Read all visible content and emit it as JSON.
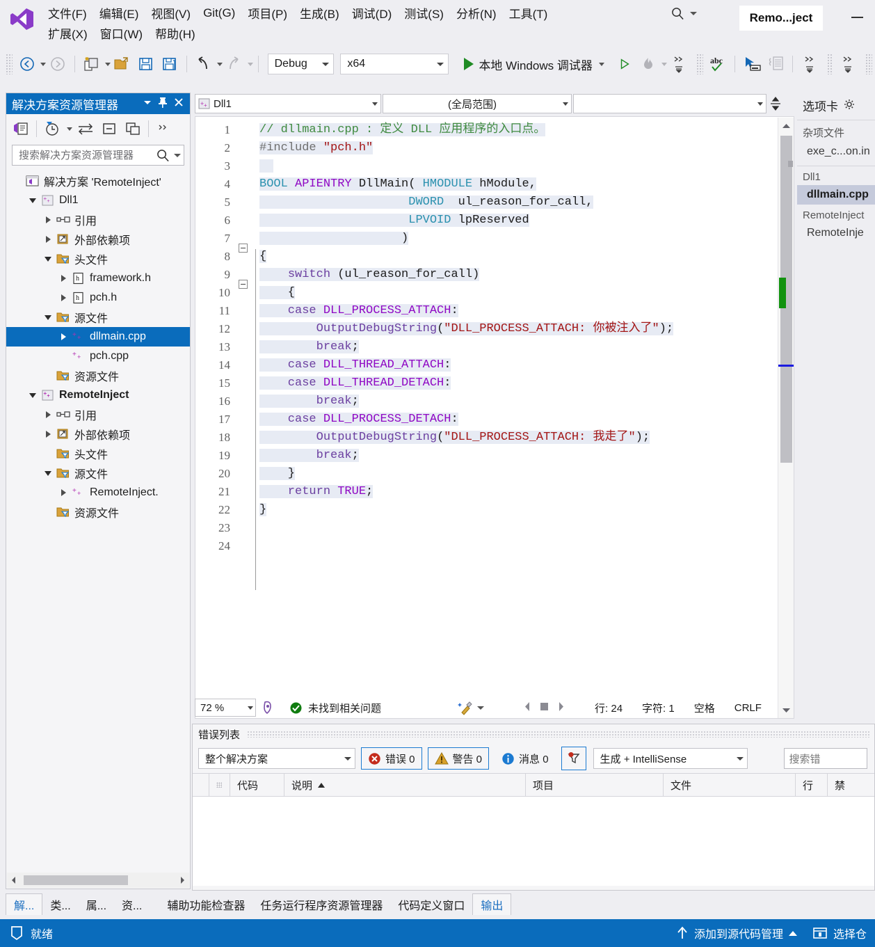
{
  "window": {
    "project_label": "Remo...ject",
    "minimize_icon": "minimize-icon"
  },
  "menubar": {
    "items": [
      {
        "text": "文件(F)",
        "accel": "F"
      },
      {
        "text": "编辑(E)",
        "accel": "E"
      },
      {
        "text": "视图(V)",
        "accel": "V"
      },
      {
        "text": "Git(G)",
        "accel": "G"
      },
      {
        "text": "项目(P)",
        "accel": "P"
      },
      {
        "text": "生成(B)",
        "accel": "B"
      },
      {
        "text": "调试(D)",
        "accel": "D"
      },
      {
        "text": "测试(S)",
        "accel": "S"
      },
      {
        "text": "分析(N)",
        "accel": "N"
      },
      {
        "text": "工具(T)",
        "accel": "T"
      },
      {
        "text": "扩展(X)",
        "accel": "X"
      },
      {
        "text": "窗口(W)",
        "accel": "W"
      },
      {
        "text": "帮助(H)",
        "accel": "H"
      }
    ],
    "row1": [
      "文件(F)",
      "编辑(E)",
      "视图(V)",
      "Git(G)",
      "项目(P)",
      "生成(B)",
      "调试(D)",
      "测试(S)",
      "分析(N)",
      "工具(T)"
    ],
    "row2": [
      "扩展(X)",
      "窗口(W)",
      "帮助(H)"
    ]
  },
  "toolbar": {
    "config": "Debug",
    "platform": "x64",
    "run_label": "本地 Windows 调试器",
    "icons": [
      "navigate-back-icon",
      "navigate-forward-icon",
      "new-item-icon",
      "open-file-icon",
      "save-icon",
      "save-all-icon",
      "undo-icon",
      "redo-icon",
      "start-debug-icon",
      "start-without-debug-icon",
      "hot-reload-icon",
      "spellcheck-icon",
      "select-element-icon",
      "layout-icon"
    ]
  },
  "solution_explorer": {
    "title": "解决方案资源管理器",
    "search_placeholder": "搜索解决方案资源管理器",
    "toolbar_icons": [
      "home-icon",
      "pending-changes-icon",
      "sync-with-active-doc-icon",
      "collapse-all-icon",
      "properties-icon",
      "overflow-icon"
    ],
    "tree": [
      {
        "label": "解决方案 'RemoteInject'",
        "indent": 0,
        "twisty": "none",
        "icon": "solution-icon",
        "selected": false,
        "bold": false
      },
      {
        "label": "Dll1",
        "indent": 1,
        "twisty": "down",
        "icon": "cpp-project-icon",
        "selected": false,
        "bold": false
      },
      {
        "label": "引用",
        "indent": 2,
        "twisty": "right",
        "icon": "references-icon",
        "selected": false,
        "bold": false
      },
      {
        "label": "外部依赖项",
        "indent": 2,
        "twisty": "right",
        "icon": "external-deps-icon",
        "selected": false,
        "bold": false
      },
      {
        "label": "头文件",
        "indent": 2,
        "twisty": "down",
        "icon": "filter-folder-icon",
        "selected": false,
        "bold": false
      },
      {
        "label": "framework.h",
        "indent": 3,
        "twisty": "right",
        "icon": "header-file-icon",
        "selected": false,
        "bold": false
      },
      {
        "label": "pch.h",
        "indent": 3,
        "twisty": "right",
        "icon": "header-file-icon",
        "selected": false,
        "bold": false
      },
      {
        "label": "源文件",
        "indent": 2,
        "twisty": "down",
        "icon": "filter-folder-icon",
        "selected": false,
        "bold": false
      },
      {
        "label": "dllmain.cpp",
        "indent": 3,
        "twisty": "right",
        "icon": "cpp-file-icon",
        "selected": true,
        "bold": false
      },
      {
        "label": "pch.cpp",
        "indent": 3,
        "twisty": "none",
        "icon": "cpp-file-icon",
        "selected": false,
        "bold": false
      },
      {
        "label": "资源文件",
        "indent": 2,
        "twisty": "none",
        "icon": "filter-folder-icon",
        "selected": false,
        "bold": false
      },
      {
        "label": "RemoteInject",
        "indent": 1,
        "twisty": "down",
        "icon": "cpp-project-icon",
        "selected": false,
        "bold": true
      },
      {
        "label": "引用",
        "indent": 2,
        "twisty": "right",
        "icon": "references-icon",
        "selected": false,
        "bold": false
      },
      {
        "label": "外部依赖项",
        "indent": 2,
        "twisty": "right",
        "icon": "external-deps-icon",
        "selected": false,
        "bold": false
      },
      {
        "label": "头文件",
        "indent": 2,
        "twisty": "none",
        "icon": "filter-folder-icon",
        "selected": false,
        "bold": false
      },
      {
        "label": "源文件",
        "indent": 2,
        "twisty": "down",
        "icon": "filter-folder-icon",
        "selected": false,
        "bold": false
      },
      {
        "label": "RemoteInject.",
        "indent": 3,
        "twisty": "right",
        "icon": "cpp-file-icon",
        "selected": false,
        "bold": false
      },
      {
        "label": "资源文件",
        "indent": 2,
        "twisty": "none",
        "icon": "filter-folder-icon",
        "selected": false,
        "bold": false
      }
    ]
  },
  "editor": {
    "nav_project": "Dll1",
    "nav_scope": "(全局范围)",
    "nav_member": "",
    "lines": [
      {
        "n": 1,
        "fold": "",
        "chg": "",
        "segs": [
          {
            "t": "// dllmain.cpp : 定义 DLL 应用程序的入口点。",
            "c": "cmt",
            "hl": true
          }
        ]
      },
      {
        "n": 2,
        "fold": "",
        "chg": "",
        "segs": [
          {
            "t": "#include ",
            "c": "mac",
            "hl": true
          },
          {
            "t": "\"pch.h\"",
            "c": "str",
            "hl": true
          }
        ]
      },
      {
        "n": 3,
        "fold": "",
        "chg": "",
        "segs": [
          {
            "t": "  ",
            "c": "pl",
            "hl": true
          }
        ]
      },
      {
        "n": 4,
        "fold": "",
        "chg": "",
        "segs": [
          {
            "t": "BOOL ",
            "c": "typ",
            "hl": true
          },
          {
            "t": "APIENTRY ",
            "c": "kw2",
            "hl": true
          },
          {
            "t": "DllMain",
            "c": "pl",
            "hl": true
          },
          {
            "t": "( ",
            "c": "pl",
            "hl": true
          },
          {
            "t": "HMODULE ",
            "c": "typ",
            "hl": true
          },
          {
            "t": "hModule,",
            "c": "pl",
            "hl": true
          }
        ]
      },
      {
        "n": 5,
        "fold": "",
        "chg": "",
        "segs": [
          {
            "t": "                     ",
            "c": "pl",
            "hl": true
          },
          {
            "t": "DWORD  ",
            "c": "typ",
            "hl": true
          },
          {
            "t": "ul_reason_for_call,",
            "c": "pl",
            "hl": true
          }
        ]
      },
      {
        "n": 6,
        "fold": "",
        "chg": "",
        "segs": [
          {
            "t": "                     ",
            "c": "pl",
            "hl": true
          },
          {
            "t": "LPVOID ",
            "c": "typ",
            "hl": true
          },
          {
            "t": "lpReserved",
            "c": "pl",
            "hl": true
          }
        ]
      },
      {
        "n": 7,
        "fold": "box",
        "chg": "",
        "segs": [
          {
            "t": "                    )",
            "c": "pl",
            "hl": true
          }
        ]
      },
      {
        "n": 8,
        "fold": "",
        "chg": "",
        "segs": [
          {
            "t": "{",
            "c": "pl",
            "hl": true
          }
        ]
      },
      {
        "n": 9,
        "fold": "box",
        "chg": "",
        "segs": [
          {
            "t": "    ",
            "c": "pl",
            "hl": true
          },
          {
            "t": "switch ",
            "c": "fn",
            "hl": true
          },
          {
            "t": "(ul_reason_for_call)",
            "c": "pl",
            "hl": true
          }
        ]
      },
      {
        "n": 10,
        "fold": "",
        "chg": "",
        "segs": [
          {
            "t": "    {",
            "c": "pl",
            "hl": true
          }
        ]
      },
      {
        "n": 11,
        "fold": "",
        "chg": "",
        "segs": [
          {
            "t": "    case ",
            "c": "fn",
            "hl": true
          },
          {
            "t": "DLL_PROCESS_ATTACH",
            "c": "kw2",
            "hl": true
          },
          {
            "t": ":",
            "c": "pl",
            "hl": true
          }
        ]
      },
      {
        "n": 12,
        "fold": "",
        "chg": "",
        "segs": [
          {
            "t": "        ",
            "c": "pl",
            "hl": true
          },
          {
            "t": "OutputDebugString",
            "c": "fn",
            "hl": true
          },
          {
            "t": "(",
            "c": "pl",
            "hl": true
          },
          {
            "t": "\"DLL_PROCESS_ATTACH: 你被注入了\"",
            "c": "str",
            "hl": true
          },
          {
            "t": ");",
            "c": "pl",
            "hl": true
          }
        ]
      },
      {
        "n": 13,
        "fold": "",
        "chg": "",
        "segs": [
          {
            "t": "        ",
            "c": "pl",
            "hl": true
          },
          {
            "t": "break",
            "c": "fn",
            "hl": true
          },
          {
            "t": ";",
            "c": "pl",
            "hl": true
          }
        ]
      },
      {
        "n": 14,
        "fold": "",
        "chg": "",
        "segs": [
          {
            "t": "    case ",
            "c": "fn",
            "hl": true
          },
          {
            "t": "DLL_THREAD_ATTACH",
            "c": "kw2",
            "hl": true
          },
          {
            "t": ":",
            "c": "pl",
            "hl": true
          }
        ]
      },
      {
        "n": 15,
        "fold": "",
        "chg": "green",
        "segs": [
          {
            "t": "    case ",
            "c": "fn",
            "hl": true
          },
          {
            "t": "DLL_THREAD_DETACH",
            "c": "kw2",
            "hl": true
          },
          {
            "t": ":",
            "c": "pl",
            "hl": true
          }
        ]
      },
      {
        "n": 16,
        "fold": "",
        "chg": "green",
        "segs": [
          {
            "t": "        ",
            "c": "pl",
            "hl": true
          },
          {
            "t": "break",
            "c": "fn",
            "hl": true
          },
          {
            "t": ";",
            "c": "pl",
            "hl": true
          }
        ]
      },
      {
        "n": 17,
        "fold": "",
        "chg": "",
        "segs": [
          {
            "t": "    case ",
            "c": "fn",
            "hl": true
          },
          {
            "t": "DLL_PROCESS_DETACH",
            "c": "kw2",
            "hl": true
          },
          {
            "t": ":",
            "c": "pl",
            "hl": true
          }
        ]
      },
      {
        "n": 18,
        "fold": "",
        "chg": "",
        "segs": [
          {
            "t": "        ",
            "c": "pl",
            "hl": true
          },
          {
            "t": "OutputDebugString",
            "c": "fn",
            "hl": true
          },
          {
            "t": "(",
            "c": "pl",
            "hl": true
          },
          {
            "t": "\"DLL_PROCESS_ATTACH: 我走了\"",
            "c": "str",
            "hl": true
          },
          {
            "t": ");",
            "c": "pl",
            "hl": true
          }
        ]
      },
      {
        "n": 19,
        "fold": "",
        "chg": "",
        "segs": [
          {
            "t": "        ",
            "c": "pl",
            "hl": true
          },
          {
            "t": "break",
            "c": "fn",
            "hl": true
          },
          {
            "t": ";",
            "c": "pl",
            "hl": true
          }
        ]
      },
      {
        "n": 20,
        "fold": "",
        "chg": "",
        "segs": [
          {
            "t": "    }",
            "c": "pl",
            "hl": true
          }
        ]
      },
      {
        "n": 21,
        "fold": "",
        "chg": "",
        "segs": [
          {
            "t": "    return ",
            "c": "fn",
            "hl": true
          },
          {
            "t": "TRUE",
            "c": "kw2",
            "hl": true
          },
          {
            "t": ";",
            "c": "pl",
            "hl": true
          }
        ]
      },
      {
        "n": 22,
        "fold": "",
        "chg": "",
        "segs": [
          {
            "t": "}",
            "c": "pl",
            "hl": true
          }
        ]
      },
      {
        "n": 23,
        "fold": "",
        "chg": "",
        "segs": [
          {
            "t": "",
            "c": "pl",
            "hl": false
          }
        ]
      },
      {
        "n": 24,
        "fold": "",
        "chg": "",
        "segs": [
          {
            "t": "",
            "c": "pl",
            "hl": false
          }
        ]
      }
    ]
  },
  "editor_status": {
    "zoom": "72 %",
    "issues": "未找到相关问题",
    "line_label": "行: 24",
    "char_label": "字符: 1",
    "indent_label": "空格",
    "eol_label": "CRLF",
    "icons": [
      "ink-icon",
      "issues-ok-icon",
      "code-cleanup-icon",
      "prev-icon",
      "stop-icon",
      "next-icon"
    ]
  },
  "tabs_panel": {
    "title": "选项卡",
    "gear_icon": "gear-icon",
    "groups": [
      {
        "header": "杂项文件",
        "items": [
          {
            "label": "exe_c...on.in",
            "active": false
          }
        ]
      },
      {
        "header": "Dll1",
        "items": [
          {
            "label": "dllmain.cpp",
            "active": true
          }
        ]
      },
      {
        "header": "RemoteInject",
        "items": [
          {
            "label": "RemoteInje",
            "active": false
          }
        ]
      }
    ]
  },
  "error_list": {
    "title": "错误列表",
    "scope": "整个解决方案",
    "errors": "错误 0",
    "warnings": "警告 0",
    "messages": "消息 0",
    "filter_icon": "filter-errors-icon",
    "build_filter": "生成 + IntelliSense",
    "search_placeholder": "搜索错",
    "columns": [
      "",
      "代码",
      "说明",
      "项目",
      "文件",
      "行",
      "禁"
    ],
    "sort_column": "说明",
    "sort_dir": "asc",
    "rows": []
  },
  "bottom_tabs": [
    {
      "label": "解...",
      "active": true
    },
    {
      "label": "类...",
      "active": false
    },
    {
      "label": "属...",
      "active": false
    },
    {
      "label": "资...",
      "active": false
    },
    {
      "label": "辅助功能检查器",
      "active": false
    },
    {
      "label": "任务运行程序资源管理器",
      "active": false
    },
    {
      "label": "代码定义窗口",
      "active": false
    },
    {
      "label": "输出",
      "active": true
    }
  ],
  "statusbar": {
    "ready": "就绪",
    "source_control": "添加到源代码管理",
    "repo": "选择仓",
    "ready_icon": "notify-icon",
    "upload_icon": "upload-arrow-icon",
    "repo_icon": "repository-icon"
  },
  "colors": {
    "accent": "#0a6cbc",
    "titlebar_bg": "#eeeef2",
    "panel_bg": "#f5f5f7",
    "editor_bg": "#ffffff",
    "selection": "#e7ebf4",
    "comment": "#3f8a3f",
    "string": "#a31515",
    "type": "#2b91af",
    "keyword": "#6b3fa0",
    "macro": "#8f08c4",
    "change_bar_green": "#16a016",
    "status_green": "#1f8b24"
  }
}
